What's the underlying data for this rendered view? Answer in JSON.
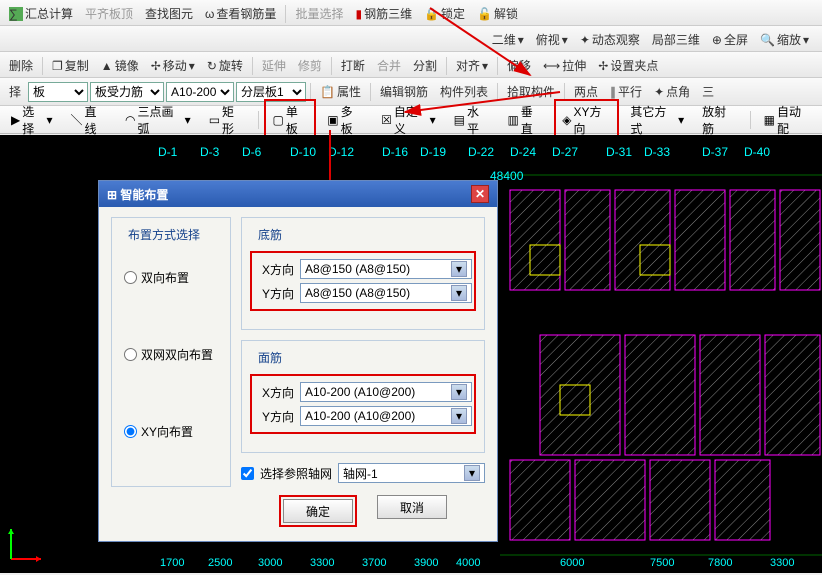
{
  "toolbar1": {
    "calc": "汇总计算",
    "align": "平齐板顶",
    "find": "查找图元",
    "rebar": "查看钢筋量",
    "batch": "批量选择",
    "rebar3d": "钢筋三维",
    "lock": "锁定",
    "unlock": "解锁"
  },
  "toolbar2": {
    "twoD": "二维",
    "thirdView": "俯视",
    "dynView": "动态观察",
    "local3d": "局部三维",
    "fullscreen": "全屏",
    "zoom": "缩放"
  },
  "toolbar3": {
    "delete": "删除",
    "copy": "复制",
    "mirror": "镜像",
    "move": "移动",
    "rotate": "旋转",
    "extend": "延伸",
    "trim": "修剪",
    "break": "打断",
    "merge": "合并",
    "split": "分割",
    "align2": "对齐",
    "offset": "偏移",
    "stretch": "拉伸",
    "grip": "设置夹点"
  },
  "toolbar4": {
    "sel1": "择",
    "board": "板",
    "boardRebar": "板受力筋",
    "a10": "A10-200",
    "layer": "分层板1",
    "attr": "属性",
    "editRebar": "编辑钢筋",
    "compList": "构件列表",
    "pickComp": "拾取构件",
    "twoPoint": "两点",
    "parallel": "平行",
    "pointAngle": "点角",
    "three": "三"
  },
  "toolbar5": {
    "select": "选择",
    "line": "直线",
    "arc3p": "三点画弧",
    "rect": "矩形",
    "single": "单板",
    "multi": "多板",
    "custom": "自定义",
    "horiz": "水平",
    "vert": "垂直",
    "xy": "XY方向",
    "other": "其它方式",
    "radial": "放射筋",
    "auto": "自动配"
  },
  "dialog": {
    "title": "智能布置",
    "methodTitle": "布置方式选择",
    "radio1": "双向布置",
    "radio2": "双网双向布置",
    "radio3": "XY向布置",
    "bottomTitle": "底筋",
    "topTitle": "面筋",
    "xdir": "X方向",
    "ydir": "Y方向",
    "bottomX": "A8@150 (A8@150)",
    "bottomY": "A8@150 (A8@150)",
    "topX": "A10-200 (A10@200)",
    "topY": "A10-200 (A10@200)",
    "refGrid": "选择参照轴网",
    "gridName": "轴网-1",
    "ok": "确定",
    "cancel": "取消"
  },
  "axes": {
    "top": [
      "D-1",
      "D-3",
      "D-6",
      "D-10",
      "D-12",
      "D-16",
      "D-19",
      "D-22",
      "D-24",
      "D-27",
      "D-31",
      "D-33",
      "D-37",
      "D-40"
    ],
    "dim": "48400",
    "bottom": [
      "1700",
      "2500",
      "3000",
      "3300",
      "3700",
      "3900",
      "4000",
      "6000",
      "7500",
      "7800",
      "3300"
    ]
  }
}
